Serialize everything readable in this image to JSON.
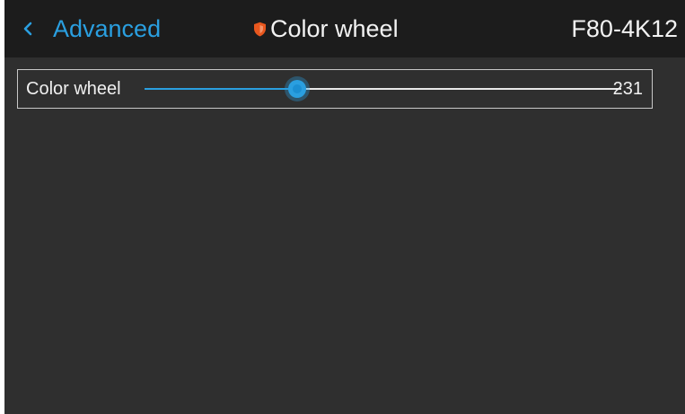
{
  "header": {
    "back_label": "Advanced",
    "back_icon": "chevron-left-icon",
    "title": "Color wheel",
    "title_icon": "shield-icon",
    "model": "F80-4K12"
  },
  "setting": {
    "label": "Color wheel",
    "value": "231",
    "position_fraction": 0.32
  },
  "colors": {
    "accent": "#2a9fe0",
    "shield": "#e8571e",
    "header_bg": "#1c1c1c",
    "body_bg": "#2f2f2f"
  }
}
